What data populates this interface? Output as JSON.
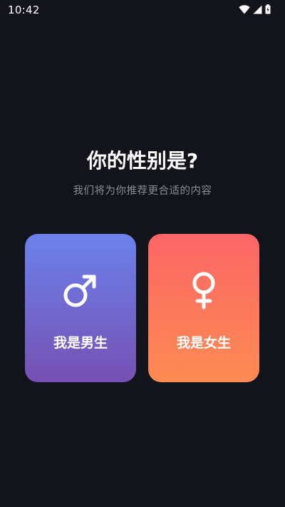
{
  "status_bar": {
    "time": "10:42"
  },
  "heading": {
    "title": "你的性别是?",
    "subtitle": "我们将为你推荐更合适的内容"
  },
  "options": {
    "male": {
      "label": "我是男生",
      "icon": "male-symbol-icon"
    },
    "female": {
      "label": "我是女生",
      "icon": "female-symbol-icon"
    }
  },
  "colors": {
    "background": "#13131b",
    "male_gradient_top": "#6b82ec",
    "male_gradient_bottom": "#7650b2",
    "female_gradient_top": "#fb6666",
    "female_gradient_bottom": "#fd8b52",
    "subtitle": "#8b8b95"
  }
}
